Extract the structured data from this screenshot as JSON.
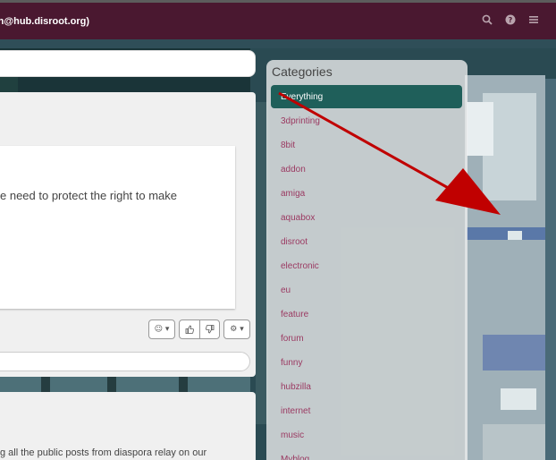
{
  "navbar": {
    "title": "th@hub.disroot.org)",
    "icons": [
      "search-icon",
      "question-icon",
      "menu-icon"
    ]
  },
  "post": {
    "text": "e need to protect the right to make"
  },
  "post2": {
    "text": "g all the public posts from diaspora relay on our"
  },
  "actions": [
    "emoji-dropdown",
    "thumbs-up",
    "thumbs-down",
    "gear-dropdown"
  ],
  "categories": {
    "title": "Categories",
    "items": [
      "Everything",
      "3dprinting",
      "8bit",
      "addon",
      "amiga",
      "aquabox",
      "disroot",
      "electronic",
      "eu",
      "feature",
      "forum",
      "funny",
      "hubzilla",
      "internet",
      "music",
      "Myblog"
    ],
    "active_index": 0
  },
  "colors": {
    "navbar": "#4a1830",
    "accent_active": "#1f5f5a",
    "category_link": "#9b3a62",
    "annotation_arrow": "#c00000"
  }
}
